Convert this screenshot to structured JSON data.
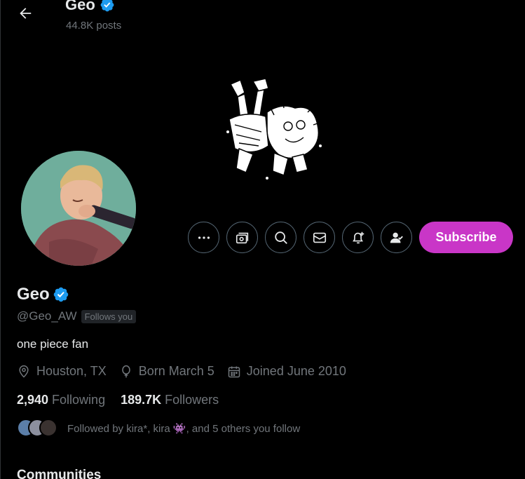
{
  "header": {
    "name": "Geo",
    "posts_count": "44.8K posts"
  },
  "profile": {
    "display_name": "Geo",
    "handle": "@Geo_AW",
    "follows_you_badge": "Follows you",
    "bio": "one piece fan",
    "location": "Houston, TX",
    "birthday": "Born March 5",
    "joined": "Joined June 2010",
    "following_count": "2,940",
    "following_label": "Following",
    "followers_count": "189.7K",
    "followers_label": "Followers",
    "followed_by_text": "Followed by kira*, kira 👾, and 5 others you follow"
  },
  "actions": {
    "subscribe_label": "Subscribe",
    "icons": [
      "more-icon",
      "subscriptions-icon",
      "search-icon",
      "message-icon",
      "notify-icon",
      "following-icon"
    ]
  },
  "sections": {
    "communities": "Communities"
  },
  "colors": {
    "accent_subscribe": "#c936c7",
    "verified_blue": "#1d9bf0",
    "text_secondary": "#71767b"
  }
}
